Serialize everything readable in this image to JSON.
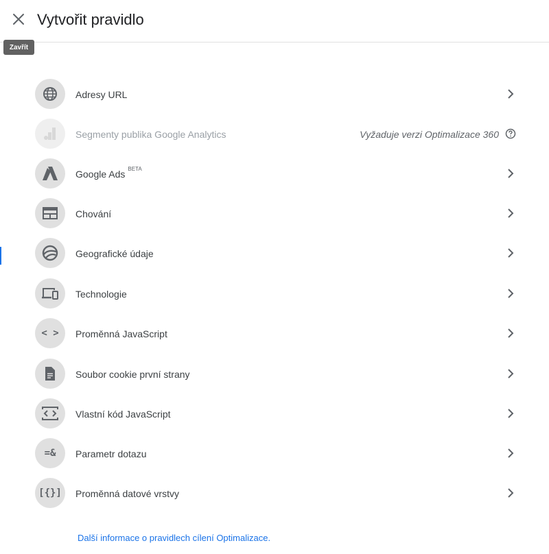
{
  "dialog": {
    "title": "Vytvořit pravidlo",
    "close_tooltip": "Zavřít"
  },
  "rules": [
    {
      "label": "Adresy URL",
      "icon": "globe-icon",
      "disabled": false
    },
    {
      "label": "Segmenty publika Google Analytics",
      "icon": "analytics-icon",
      "disabled": true,
      "note": "Vyžaduje verzi Optimalizace 360"
    },
    {
      "label": "Google Ads",
      "badge": "BETA",
      "icon": "google-ads-icon",
      "disabled": false
    },
    {
      "label": "Chování",
      "icon": "web-layout-icon",
      "disabled": false
    },
    {
      "label": "Geografické údaje",
      "icon": "earth-icon",
      "disabled": false
    },
    {
      "label": "Technologie",
      "icon": "devices-icon",
      "disabled": false
    },
    {
      "label": "Proměnná JavaScript",
      "icon": "code-icon",
      "glyph": "< >",
      "disabled": false
    },
    {
      "label": "Soubor cookie první strany",
      "icon": "document-icon",
      "disabled": false
    },
    {
      "label": "Vlastní kód JavaScript",
      "icon": "settings-ethernet-icon",
      "disabled": false
    },
    {
      "label": "Parametr dotazu",
      "icon": "query-param-icon",
      "glyph": "=&",
      "disabled": false
    },
    {
      "label": "Proměnná datové vrstvy",
      "icon": "data-layer-icon",
      "glyph": "[{}]",
      "disabled": false
    }
  ],
  "footer": {
    "link_text": "Další informace o pravidlech cílení Optimalizace."
  },
  "colors": {
    "accent": "#1a73e8",
    "icon_bg": "#e0e0e0",
    "icon_fg": "#5f6368",
    "tooltip_bg": "#616161"
  }
}
